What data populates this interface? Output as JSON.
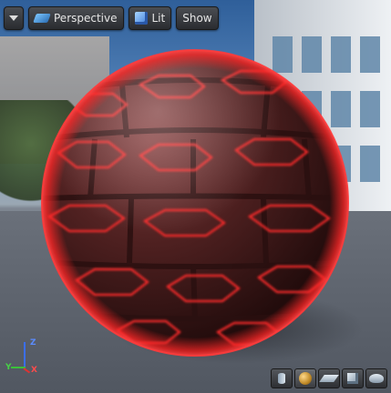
{
  "toolbar": {
    "dropdown_icon": "chevron-down-icon",
    "perspective_label": "Perspective",
    "lit_label": "Lit",
    "show_label": "Show"
  },
  "axes": {
    "x": "X",
    "y": "Y",
    "z": "Z"
  },
  "preview_shapes": [
    "cylinder",
    "sphere",
    "plane",
    "cube",
    "teapot"
  ],
  "selected_shape": "sphere",
  "colors": {
    "glow": "#ff2a2a",
    "brick": "#5a2525",
    "mortar": "#2a1414"
  }
}
